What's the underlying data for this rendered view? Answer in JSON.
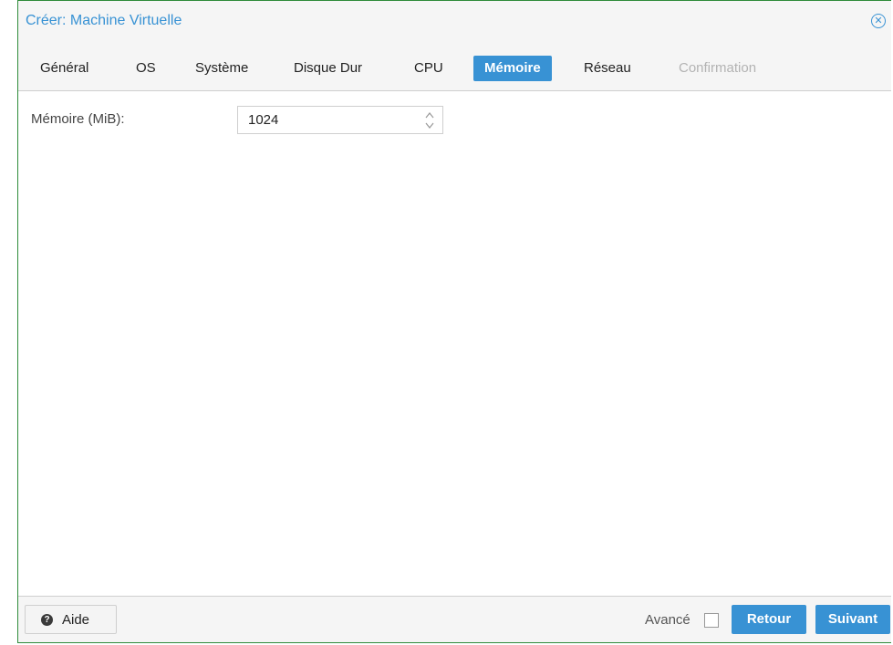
{
  "window": {
    "title": "Créer: Machine Virtuelle",
    "close_icon": "close-circle-icon"
  },
  "tabs": [
    {
      "label": "Général",
      "state": "normal"
    },
    {
      "label": "OS",
      "state": "normal"
    },
    {
      "label": "Système",
      "state": "normal"
    },
    {
      "label": "Disque Dur",
      "state": "normal"
    },
    {
      "label": "CPU",
      "state": "normal"
    },
    {
      "label": "Mémoire",
      "state": "active"
    },
    {
      "label": "Réseau",
      "state": "normal"
    },
    {
      "label": "Confirmation",
      "state": "disabled"
    }
  ],
  "memory": {
    "label": "Mémoire (MiB):",
    "value": "1024"
  },
  "footer": {
    "help_label": "Aide",
    "advanced_label": "Avancé",
    "advanced_checked": false,
    "back_label": "Retour",
    "next_label": "Suivant"
  },
  "colors": {
    "accent": "#3892d4",
    "border": "#2e8b3a"
  }
}
